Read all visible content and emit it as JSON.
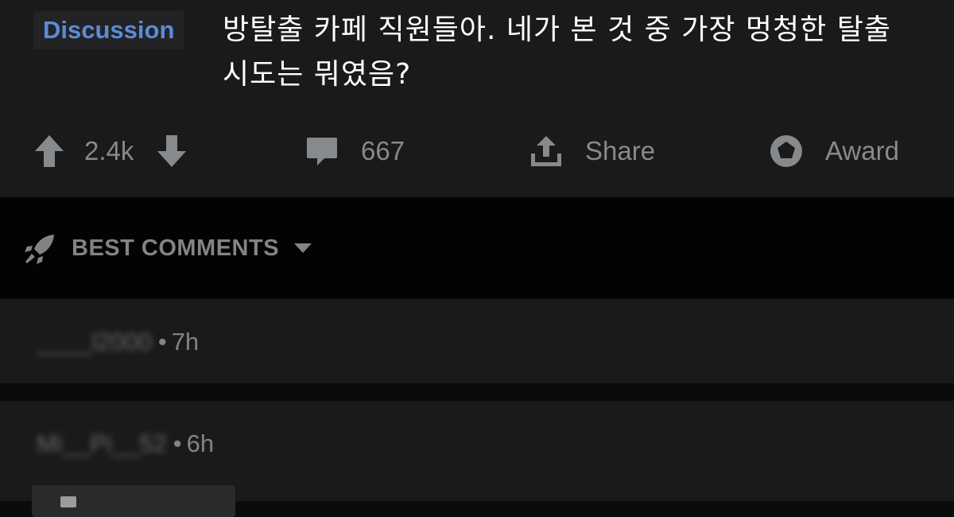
{
  "post": {
    "flair": "Discussion",
    "title": "방탈출 카페 직원들아. 네가 본 것 중 가장 멍청한 탈출 시도는 뭐였음?"
  },
  "actions": {
    "upvote_icon": "arrow-up-icon",
    "vote_count": "2.4k",
    "downvote_icon": "arrow-down-icon",
    "comment_icon": "comment-bubble-icon",
    "comment_count": "667",
    "share_icon": "share-upload-icon",
    "share_label": "Share",
    "award_icon": "award-badge-icon",
    "award_label": "Award"
  },
  "sort": {
    "icon": "rocket-icon",
    "label": "BEST COMMENTS",
    "dropdown_icon": "caret-down-icon"
  },
  "comments": [
    {
      "username": "____l2000",
      "separator": "•",
      "time": "7h"
    },
    {
      "username": "Mi__Pi__52",
      "separator": "•",
      "time": "6h"
    }
  ],
  "colors": {
    "page_bg": "#0b0b0c",
    "card_bg": "#1a1a1b",
    "band_bg": "#030303",
    "flair_text": "#5c8bd6",
    "title_text": "#ffffff",
    "muted_text": "#878a8c"
  }
}
